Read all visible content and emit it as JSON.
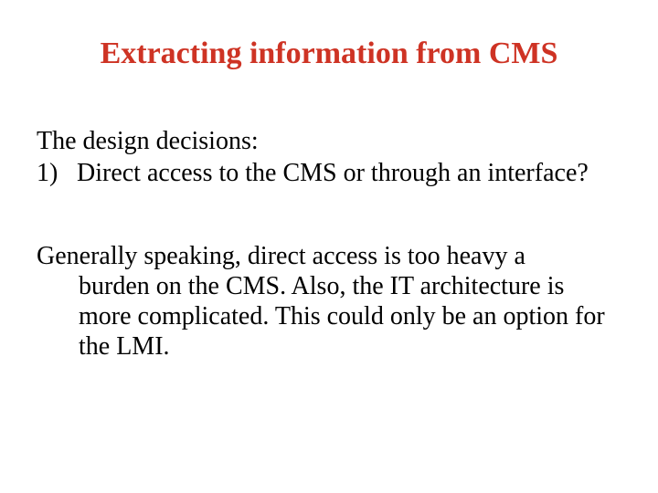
{
  "title": "Extracting information from CMS",
  "intro": "The design decisions:",
  "list": {
    "num": "1)",
    "text": "Direct access to the CMS or through an interface?"
  },
  "para2": {
    "first": "Generally speaking, direct access is too heavy a",
    "rest": "burden on the CMS. Also, the IT architecture is more complicated. This could only be an option for the LMI."
  }
}
